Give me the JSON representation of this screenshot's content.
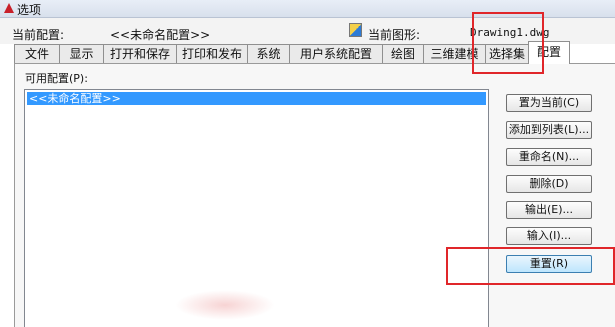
{
  "window": {
    "title": "选项"
  },
  "header": {
    "current_profile_label": "当前配置:",
    "current_profile_value": "<<未命名配置>>",
    "current_drawing_label": "当前图形:",
    "current_drawing_value": "Drawing1.dwg"
  },
  "tabs": [
    {
      "label": "文件"
    },
    {
      "label": "显示"
    },
    {
      "label": "打开和保存"
    },
    {
      "label": "打印和发布"
    },
    {
      "label": "系统"
    },
    {
      "label": "用户系统配置"
    },
    {
      "label": "绘图"
    },
    {
      "label": "三维建模"
    },
    {
      "label": "选择集"
    },
    {
      "label": "配置",
      "active": true
    }
  ],
  "profiles": {
    "label": "可用配置(P):",
    "items": [
      "<<未命名配置>>"
    ],
    "selected": "<<未命名配置>>"
  },
  "buttons": {
    "set_current": "置为当前(C)",
    "add_to_list": "添加到列表(L)...",
    "rename": "重命名(N)...",
    "delete": "删除(D)",
    "export": "输出(E)...",
    "import": "输入(I)...",
    "reset": "重置(R)"
  },
  "annotation_color": "#e0262a"
}
